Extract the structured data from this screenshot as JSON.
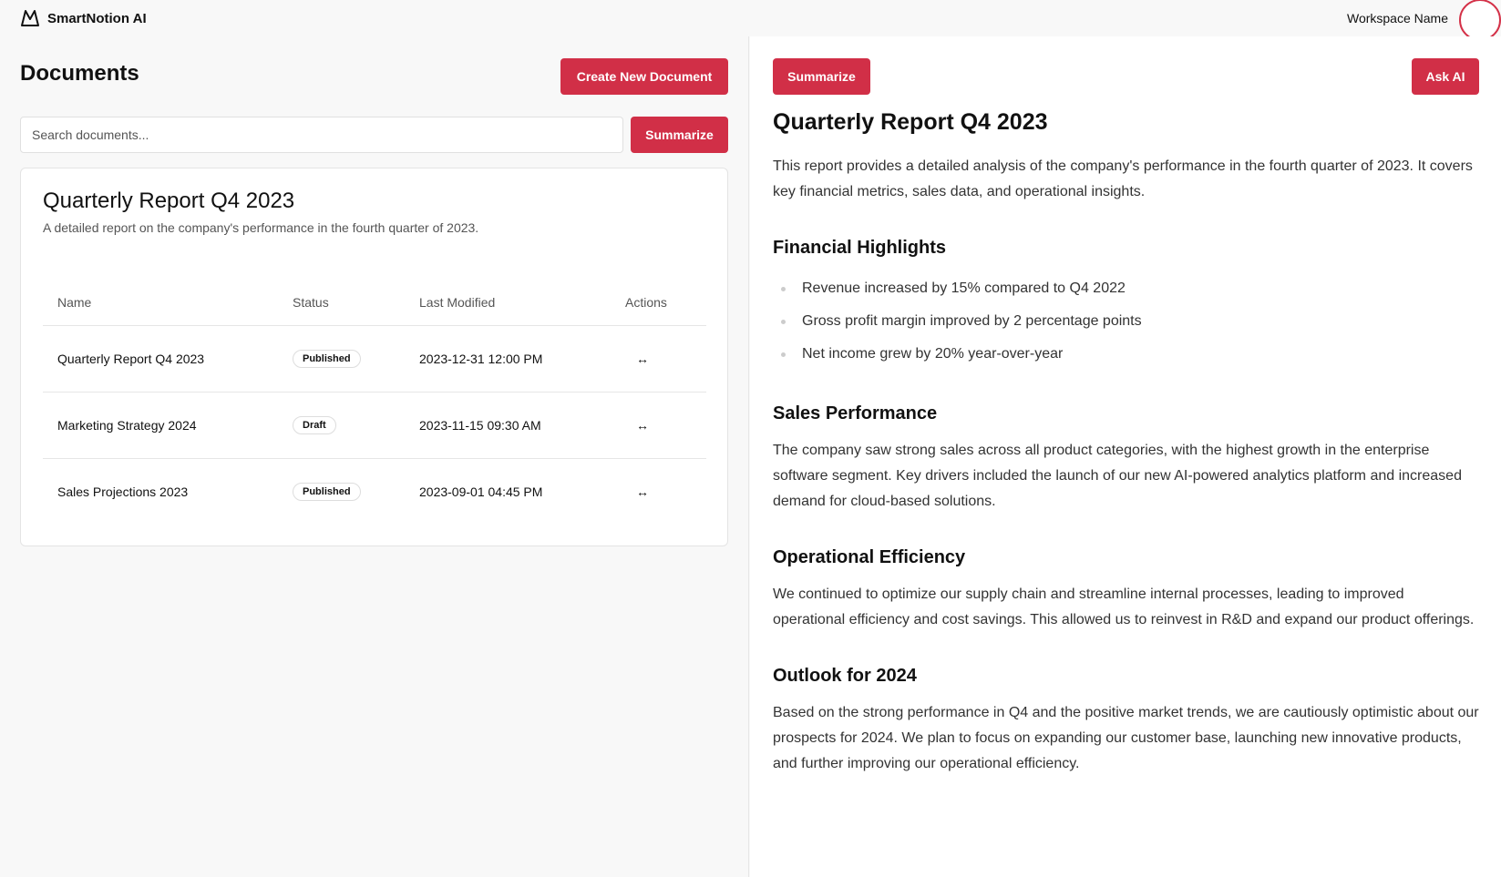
{
  "app": {
    "name": "SmartNotion AI",
    "workspace": "Workspace Name"
  },
  "left": {
    "title": "Documents",
    "create_label": "Create New Document",
    "search_placeholder": "Search documents...",
    "summarize_label": "Summarize",
    "card": {
      "title": "Quarterly Report Q4 2023",
      "subtitle": "A detailed report on the company's performance in the fourth quarter of 2023.",
      "columns": [
        "Name",
        "Status",
        "Last Modified",
        "Actions"
      ],
      "rows": [
        {
          "name": "Quarterly Report Q4 2023",
          "status": "Published",
          "modified": "2023-12-31 12:00 PM",
          "action": "↔"
        },
        {
          "name": "Marketing Strategy 2024",
          "status": "Draft",
          "modified": "2023-11-15 09:30 AM",
          "action": "↔"
        },
        {
          "name": "Sales Projections 2023",
          "status": "Published",
          "modified": "2023-09-01 04:45 PM",
          "action": "↔"
        }
      ]
    }
  },
  "right": {
    "summarize_label": "Summarize",
    "ask_label": "Ask AI",
    "doc": {
      "title": "Quarterly Report Q4 2023",
      "intro": "This report provides a detailed analysis of the company's performance in the fourth quarter of 2023. It covers key financial metrics, sales data, and operational insights.",
      "financial_heading": "Financial Highlights",
      "financial_items": [
        "Revenue increased by 15% compared to Q4 2022",
        "Gross profit margin improved by 2 percentage points",
        "Net income grew by 20% year-over-year"
      ],
      "sales_heading": "Sales Performance",
      "sales_text": "The company saw strong sales across all product categories, with the highest growth in the enterprise software segment. Key drivers included the launch of our new AI-powered analytics platform and increased demand for cloud-based solutions.",
      "ops_heading": "Operational Efficiency",
      "ops_text": "We continued to optimize our supply chain and streamline internal processes, leading to improved operational efficiency and cost savings. This allowed us to reinvest in R&D and expand our product offerings.",
      "outlook_heading": "Outlook for 2024",
      "outlook_text": "Based on the strong performance in Q4 and the positive market trends, we are cautiously optimistic about our prospects for 2024. We plan to focus on expanding our customer base, launching new innovative products, and further improving our operational efficiency."
    }
  },
  "colors": {
    "accent": "#d12f47",
    "background": "#f8f8f8",
    "surface": "#ffffff"
  },
  "icons": {
    "logo": "mountain-logo-icon",
    "action": "arrows-horizontal-icon"
  }
}
